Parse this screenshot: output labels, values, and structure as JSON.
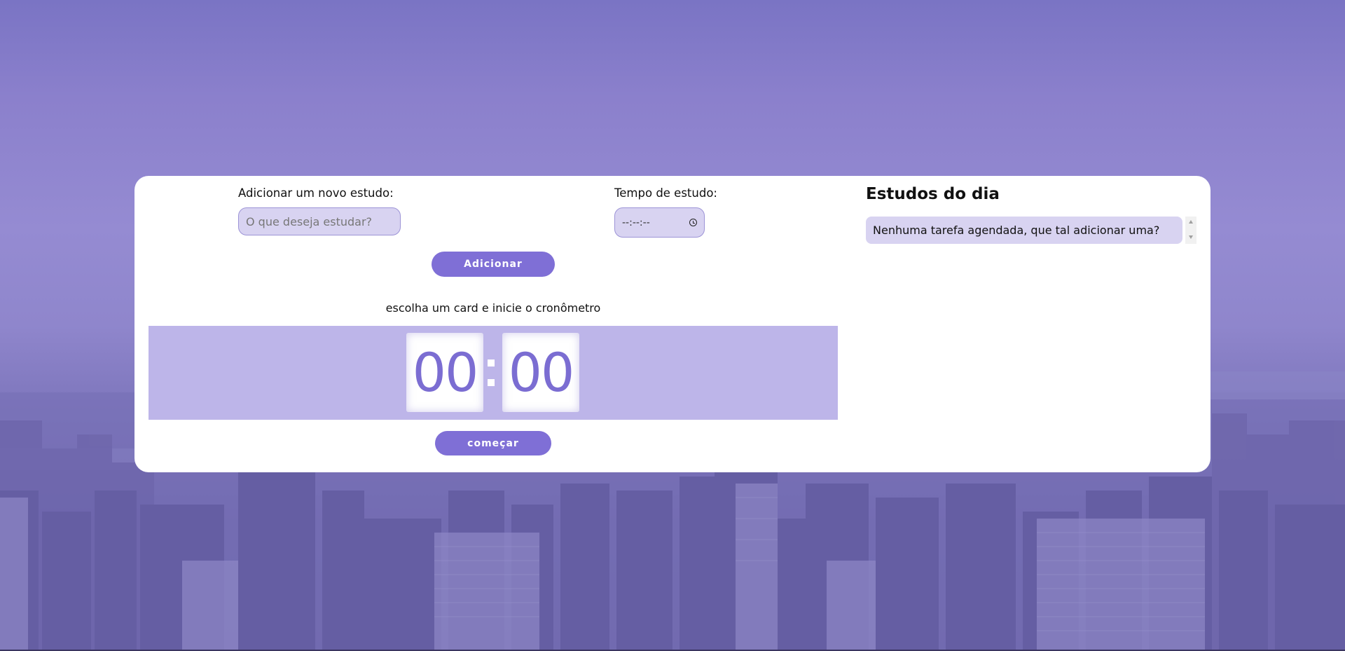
{
  "form": {
    "new_study_label": "Adicionar um novo estudo:",
    "new_study_placeholder": "O que deseja estudar?",
    "time_label": "Tempo de estudo:",
    "time_value": "--:--:--",
    "add_button": "Adicionar"
  },
  "timer": {
    "hint": "escolha um card e inicie o cronômetro",
    "minutes": "00",
    "seconds": "00",
    "start_button": "começar"
  },
  "sidebar": {
    "title": "Estudos do dia",
    "tasks": [
      "Nenhuma tarefa agendada, que tal adicionar uma?"
    ]
  },
  "colors": {
    "accent": "#7f6fd6",
    "input_bg": "#d8d3f1",
    "timer_panel": "#bdb5e9",
    "digit": "#7b6dd2"
  },
  "icons": {
    "time_picker": "clock-icon",
    "scroll_up": "scroll-up-arrow-icon",
    "scroll_down": "scroll-down-arrow-icon"
  }
}
